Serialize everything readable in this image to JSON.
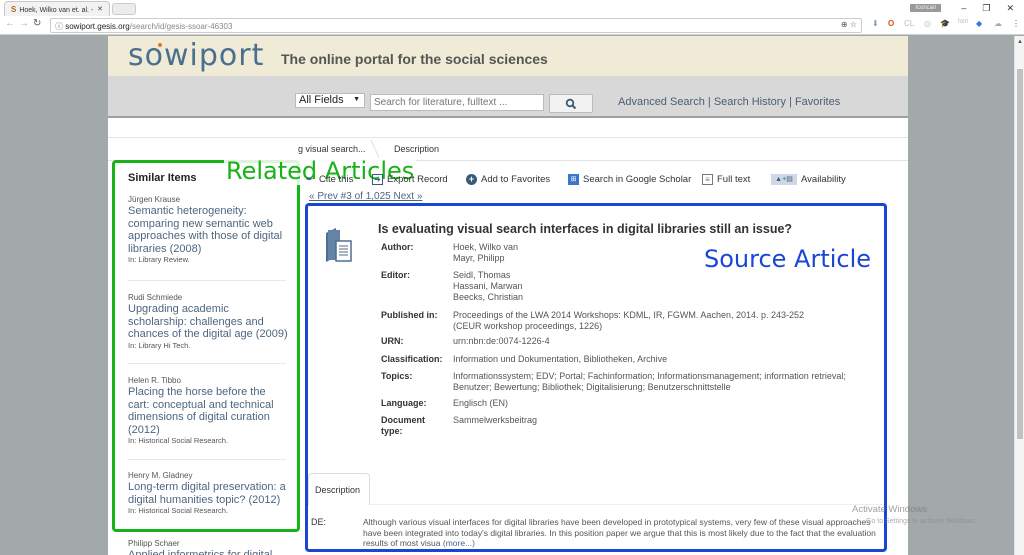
{
  "browser": {
    "tab_title": "Hoek, Wilko van et. al. -",
    "tab_favicon": "S",
    "url_host": "sowiport.gesis.org",
    "url_path": "/search/id/gesis-ssoar-46303",
    "user_badge": "Iconcan",
    "win_min": "–",
    "win_max": "❐",
    "win_close": "✕"
  },
  "header": {
    "logo": "sowiport",
    "tagline": "The online portal for the social sciences"
  },
  "search": {
    "field_select": "All Fields",
    "placeholder": "Search for literature, fulltext ...",
    "button_icon": "search-icon",
    "links": [
      "Advanced Search",
      "Search History",
      "Favorites"
    ]
  },
  "breadcrumbs": [
    "g visual search...",
    "Description"
  ],
  "annotations": {
    "related": "Related Articles",
    "source": "Source Article"
  },
  "sidebar": {
    "title": "Similar Items",
    "items": [
      {
        "author": "Jürgen Krause",
        "title": "Semantic heterogeneity: comparing new semantic web approaches with those of digital libraries (2008)",
        "source": "In: Library Review."
      },
      {
        "author": "Rudi Schmiede",
        "title": "Upgrading academic scholarship: challenges and chances of the digital age (2009)",
        "source": "In: Library Hi Tech."
      },
      {
        "author": "Helen R. Tibbo",
        "title": "Placing the horse before the cart: conceptual and technical dimensions of digital curation (2012)",
        "source": "In: Historical Social Research."
      },
      {
        "author": "Henry M. Gladney",
        "title": "Long-term digital preservation: a digital humanities topic? (2012)",
        "source": "In: Historical Social Research."
      },
      {
        "author": "Philipp Schaer",
        "title": "Applied informetrics for digital",
        "source": ""
      }
    ]
  },
  "toolbar": {
    "items": [
      {
        "label": "Cite this",
        "icon": "pen-icon"
      },
      {
        "label": "Export Record",
        "icon": "export-icon"
      },
      {
        "label": "Add to Favorites",
        "icon": "plus-circle-icon"
      },
      {
        "label": "Search in Google Scholar",
        "icon": "scholar-icon"
      },
      {
        "label": "Full text",
        "icon": "document-icon"
      },
      {
        "label": "Availability",
        "icon": "availability-icon"
      }
    ],
    "pager": "« Prev #3 of 1,025 Next »"
  },
  "article": {
    "title": "Is evaluating visual search interfaces in digital libraries still an issue?",
    "fields": [
      {
        "key": "Author:",
        "value": [
          "Hoek, Wilko van",
          "Mayr, Philipp"
        ]
      },
      {
        "key": "Editor:",
        "value": [
          "Seidl, Thomas",
          "Hassani, Marwan",
          "Beecks, Christian"
        ]
      },
      {
        "key": "Published in:",
        "value": [
          "Proceedings of the LWA 2014 Workshops: KDML, IR, FGWM. Aachen, 2014. p. 243-252",
          "(CEUR workshop proceedings, 1226)"
        ]
      },
      {
        "key": "URN:",
        "value": [
          "urn:nbn:de:0074-1226-4"
        ]
      },
      {
        "key": "Classification:",
        "value": [
          "Information und Dokumentation, Bibliotheken, Archive"
        ]
      },
      {
        "key": "Topics:",
        "value": [
          "Informationssystem; EDV; Portal; Fachinformation; Informationsmanagement; information retrieval;",
          "Benutzer; Bewertung; Bibliothek; Digitalisierung; Benutzerschnittstelle"
        ]
      },
      {
        "key": "Language:",
        "value": [
          "Englisch (EN)"
        ]
      },
      {
        "key": "Document type:",
        "value": [
          "Sammelwerksbeitrag"
        ]
      }
    ],
    "description_tab": "Description",
    "description_lang": "DE:",
    "description_text": "Although various visual interfaces for digital libraries have been developed in prototypical systems, very few of these visual approaches have been integrated into today's digital libraries. In this position paper we argue that this is most likely due to the fact that the evaluation results of most visua",
    "more_link": "(more...)"
  },
  "os": {
    "activate_title": "Activate Windows",
    "activate_sub": "Go to Settings to activate Windows."
  }
}
